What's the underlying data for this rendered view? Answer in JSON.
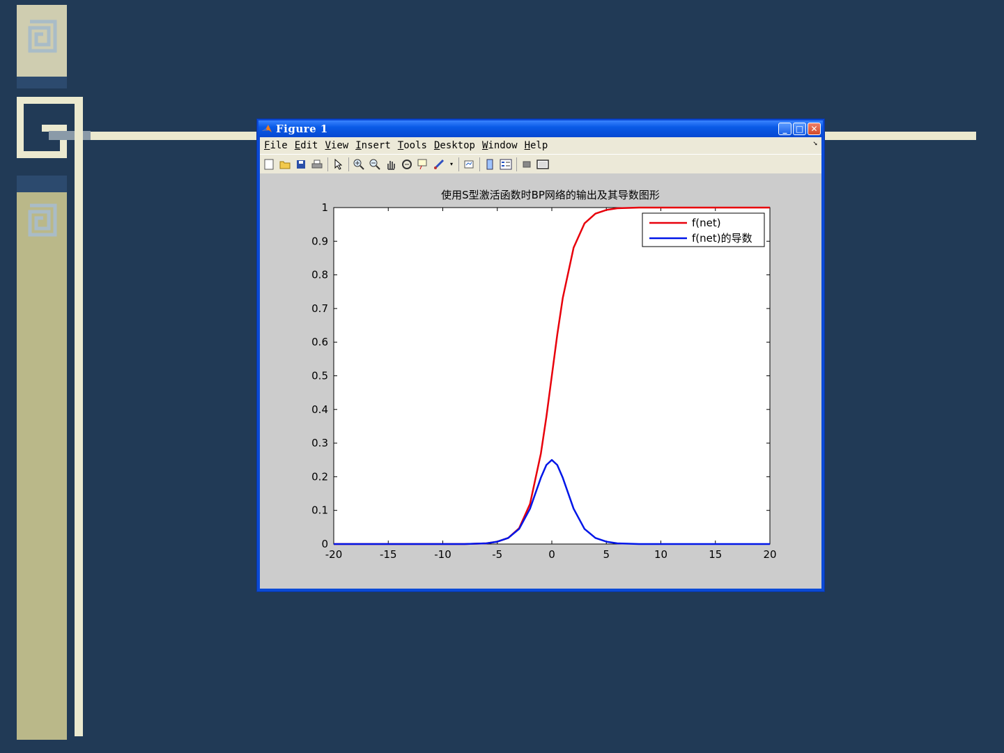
{
  "window": {
    "title": "Figure 1",
    "menus": [
      "File",
      "Edit",
      "View",
      "Insert",
      "Tools",
      "Desktop",
      "Window",
      "Help"
    ],
    "toolbar_icons": [
      "new-figure-icon",
      "open-file-icon",
      "save-icon",
      "print-icon",
      "pointer-icon",
      "zoom-in-icon",
      "zoom-out-icon",
      "pan-icon",
      "rotate-3d-icon",
      "data-cursor-icon",
      "brush-icon",
      "link-plot-icon",
      "colorbar-icon",
      "legend-icon",
      "hide-plot-tools-icon",
      "show-plot-tools-icon"
    ]
  },
  "colors": {
    "background": "#213a56",
    "series_output": "#e8000b",
    "series_derivative": "#0016e8"
  },
  "chart_data": {
    "type": "line",
    "title": "使用S型激活函数时BP网络的输出及其导数图形",
    "xlabel": "",
    "ylabel": "",
    "xlim": [
      -20,
      20
    ],
    "ylim": [
      0,
      1
    ],
    "xticks": [
      "-20",
      "-15",
      "-10",
      "-5",
      "0",
      "5",
      "10",
      "15",
      "20"
    ],
    "yticks": [
      "0",
      "0.1",
      "0.2",
      "0.3",
      "0.4",
      "0.5",
      "0.6",
      "0.7",
      "0.8",
      "0.9",
      "1"
    ],
    "grid": false,
    "legend_position": "top-right",
    "x": [
      -20,
      -19,
      -18,
      -17,
      -16,
      -15,
      -14,
      -13,
      -12,
      -11,
      -10,
      -9,
      -8,
      -7,
      -6,
      -5,
      -4,
      -3,
      -2,
      -1,
      -0.5,
      0,
      0.5,
      1,
      2,
      3,
      4,
      5,
      6,
      7,
      8,
      9,
      10,
      11,
      12,
      13,
      14,
      15,
      16,
      17,
      18,
      19,
      20
    ],
    "series": [
      {
        "name": "f(net)",
        "values": [
          0,
          0,
          0,
          0,
          0,
          0,
          0,
          0,
          0,
          0,
          0,
          0,
          0,
          0.001,
          0.002,
          0.007,
          0.018,
          0.047,
          0.119,
          0.269,
          0.378,
          0.5,
          0.622,
          0.731,
          0.881,
          0.953,
          0.982,
          0.993,
          0.998,
          0.999,
          1,
          1,
          1,
          1,
          1,
          1,
          1,
          1,
          1,
          1,
          1,
          1,
          1
        ]
      },
      {
        "name": "f(net)的导数",
        "values": [
          0,
          0,
          0,
          0,
          0,
          0,
          0,
          0,
          0,
          0,
          0,
          0,
          0,
          0.001,
          0.002,
          0.007,
          0.018,
          0.045,
          0.105,
          0.197,
          0.235,
          0.25,
          0.235,
          0.197,
          0.105,
          0.045,
          0.018,
          0.007,
          0.002,
          0.001,
          0,
          0,
          0,
          0,
          0,
          0,
          0,
          0,
          0,
          0,
          0,
          0,
          0
        ]
      }
    ]
  }
}
